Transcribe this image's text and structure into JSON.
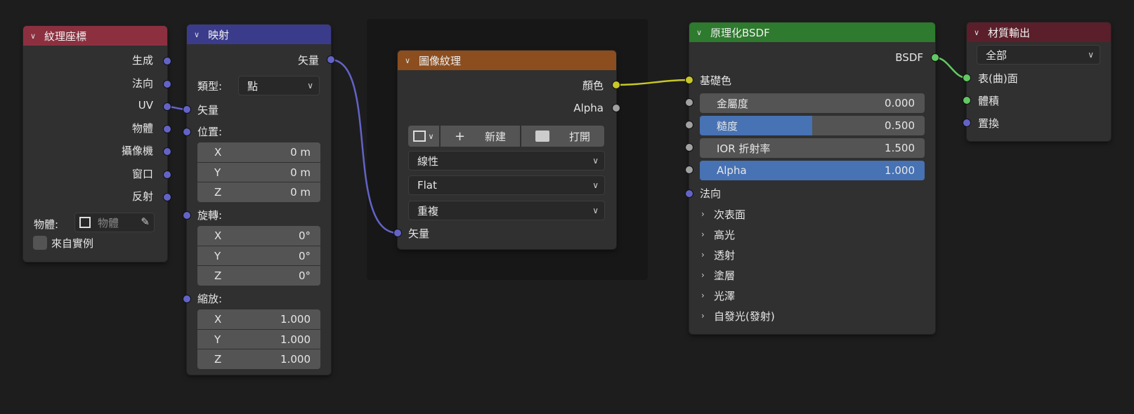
{
  "nodes": {
    "texcoord": {
      "title": "紋理座標",
      "header_color": "#8c3040",
      "outputs": [
        "生成",
        "法向",
        "UV",
        "物體",
        "攝像機",
        "窗口",
        "反射"
      ],
      "object_label": "物體:",
      "object_placeholder": "物體",
      "from_instancer_label": "來自實例"
    },
    "mapping": {
      "title": "映射",
      "header_color": "#3b3b8c",
      "output_vector": "矢量",
      "type_label": "類型:",
      "type_value": "點",
      "input_vector": "矢量",
      "location_label": "位置:",
      "location": [
        {
          "axis": "X",
          "value": "0 m"
        },
        {
          "axis": "Y",
          "value": "0 m"
        },
        {
          "axis": "Z",
          "value": "0 m"
        }
      ],
      "rotation_label": "旋轉:",
      "rotation": [
        {
          "axis": "X",
          "value": "0°"
        },
        {
          "axis": "Y",
          "value": "0°"
        },
        {
          "axis": "Z",
          "value": "0°"
        }
      ],
      "scale_label": "縮放:",
      "scale": [
        {
          "axis": "X",
          "value": "1.000"
        },
        {
          "axis": "Y",
          "value": "1.000"
        },
        {
          "axis": "Z",
          "value": "1.000"
        }
      ]
    },
    "image_texture": {
      "title": "圖像紋理",
      "header_color": "#8c4e1f",
      "outputs": [
        "顏色",
        "Alpha"
      ],
      "new_label": "新建",
      "open_label": "打開",
      "interpolation": "線性",
      "projection": "Flat",
      "extension": "重複",
      "input_vector": "矢量"
    },
    "bsdf": {
      "title": "原理化BSDF",
      "header_color": "#2e7a2e",
      "output": "BSDF",
      "base_color_label": "基礎色",
      "fields": [
        {
          "label": "金屬度",
          "value": "0.000",
          "fill": 0.0
        },
        {
          "label": "糙度",
          "value": "0.500",
          "fill": 0.5
        },
        {
          "label": "IOR 折射率",
          "value": "1.500",
          "fill": 0.0
        },
        {
          "label": "Alpha",
          "value": "1.000",
          "fill": 1.0
        }
      ],
      "normal_label": "法向",
      "panels": [
        "次表面",
        "高光",
        "透射",
        "塗層",
        "光澤",
        "自發光(發射)"
      ]
    },
    "material_output": {
      "title": "材質輸出",
      "header_color": "#5a1f2a",
      "target": "全部",
      "inputs": [
        "表(曲)面",
        "體積",
        "置換"
      ]
    }
  },
  "colors": {
    "vector_socket": "#6363c7",
    "color_socket": "#c7c729",
    "float_socket": "#a1a1a1",
    "shader_socket": "#63c763",
    "accent": "#4772b3"
  }
}
